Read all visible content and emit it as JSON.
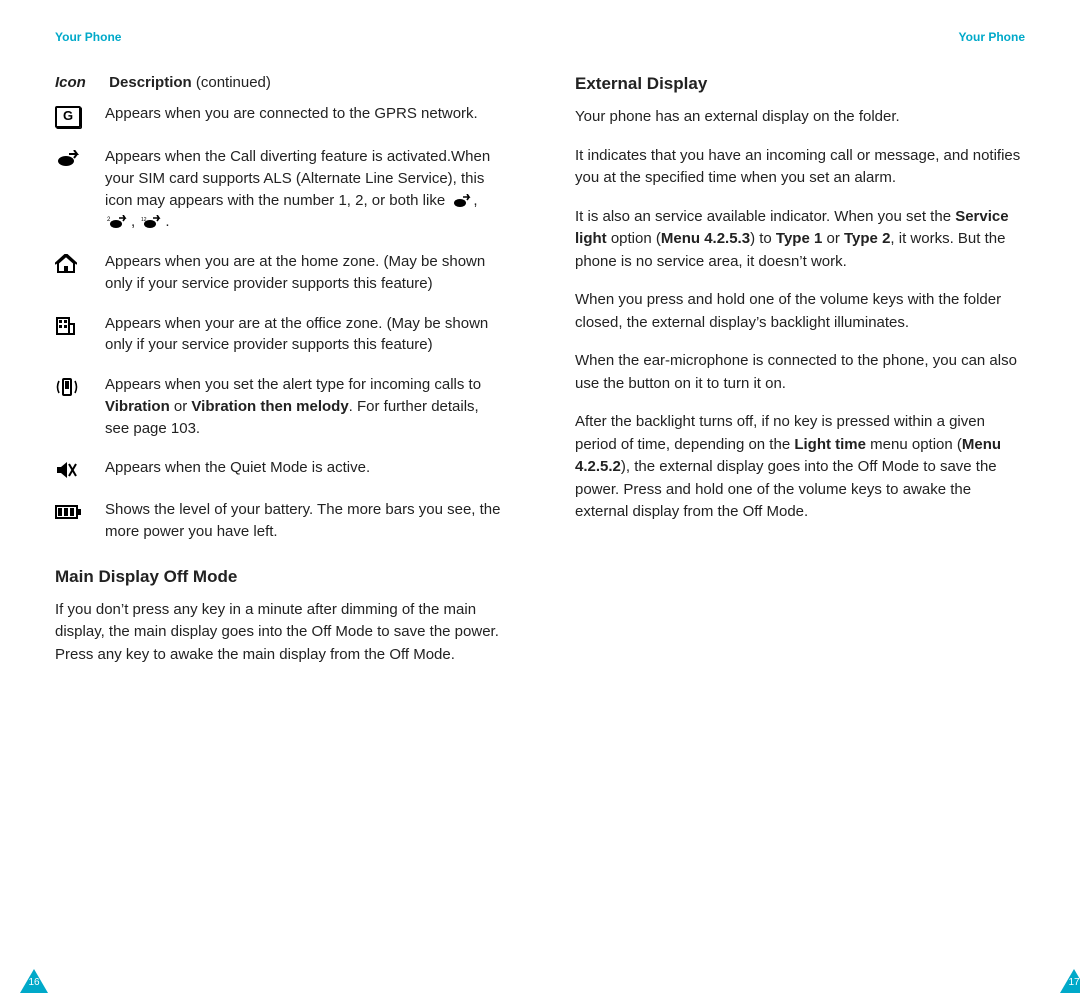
{
  "running_head_left": "Your Phone",
  "running_head_right": "Your Phone",
  "page_number_left": "16",
  "page_number_right": "17",
  "icon_table": {
    "head_icon": "Icon",
    "head_desc_bold": "Description",
    "head_desc_paren": " (continued)",
    "rows": {
      "gprs": "Appears when you are connected to the GPRS network.",
      "divert_pre": "Appears when the Call diverting feature is activated.When your SIM card supports ALS (Alternate Line Service), this icon may appears with the number 1, 2, or both like ",
      "divert_post": ".",
      "home_zone": "Appears when you are at the home zone. (May be shown only if your service provider supports this feature)",
      "office_zone": "Appears when your are at the office zone. (May be shown only if your service provider supports this feature)",
      "vibration_pre": "Appears when you set the alert type for incoming calls to ",
      "vibration_b1": "Vibration",
      "vibration_mid": " or ",
      "vibration_b2": "Vibration then melody",
      "vibration_post": ". For further details, see page 103.",
      "quiet": "Appears when the Quiet Mode is active.",
      "battery": "Shows the level of your battery. The more bars you see, the more power you have left."
    }
  },
  "left_section_heading": "Main Display Off Mode",
  "left_section_body": "If you don’t press any key in a minute after dimming of the main display, the main display goes into the Off Mode to save the power. Press any key to awake the main display from the Off Mode.",
  "right_section_heading": "External Display",
  "right_p1": "Your phone has an external display on the folder.",
  "right_p2": "It indicates that you have an incoming call or message, and notifies you at the specified time when you set an alarm.",
  "right_p3_pre": "It is also an service available indicator. When you set the ",
  "right_p3_b1": "Service light",
  "right_p3_mid1": " option (",
  "right_p3_b2": "Menu 4.2.5.3",
  "right_p3_mid2": ") to ",
  "right_p3_b3": "Type 1",
  "right_p3_mid3": " or ",
  "right_p3_b4": "Type 2",
  "right_p3_post": ", it works. But the phone is no service area, it doesn’t work.",
  "right_p4": "When you press and hold one of the volume keys with the folder closed, the external display’s backlight illuminates.",
  "right_p5": "When the ear-microphone is connected to the phone, you can also use the button on it to turn it on.",
  "right_p6_pre": "After the backlight turns off, if no key is pressed within a given period of time, depending on the ",
  "right_p6_b1": "Light time",
  "right_p6_mid1": " menu option (",
  "right_p6_b2": "Menu 4.2.5.2",
  "right_p6_post": "), the external display goes into the Off Mode to save the power. Press and hold one of the volume keys to awake the external display from the Off Mode."
}
